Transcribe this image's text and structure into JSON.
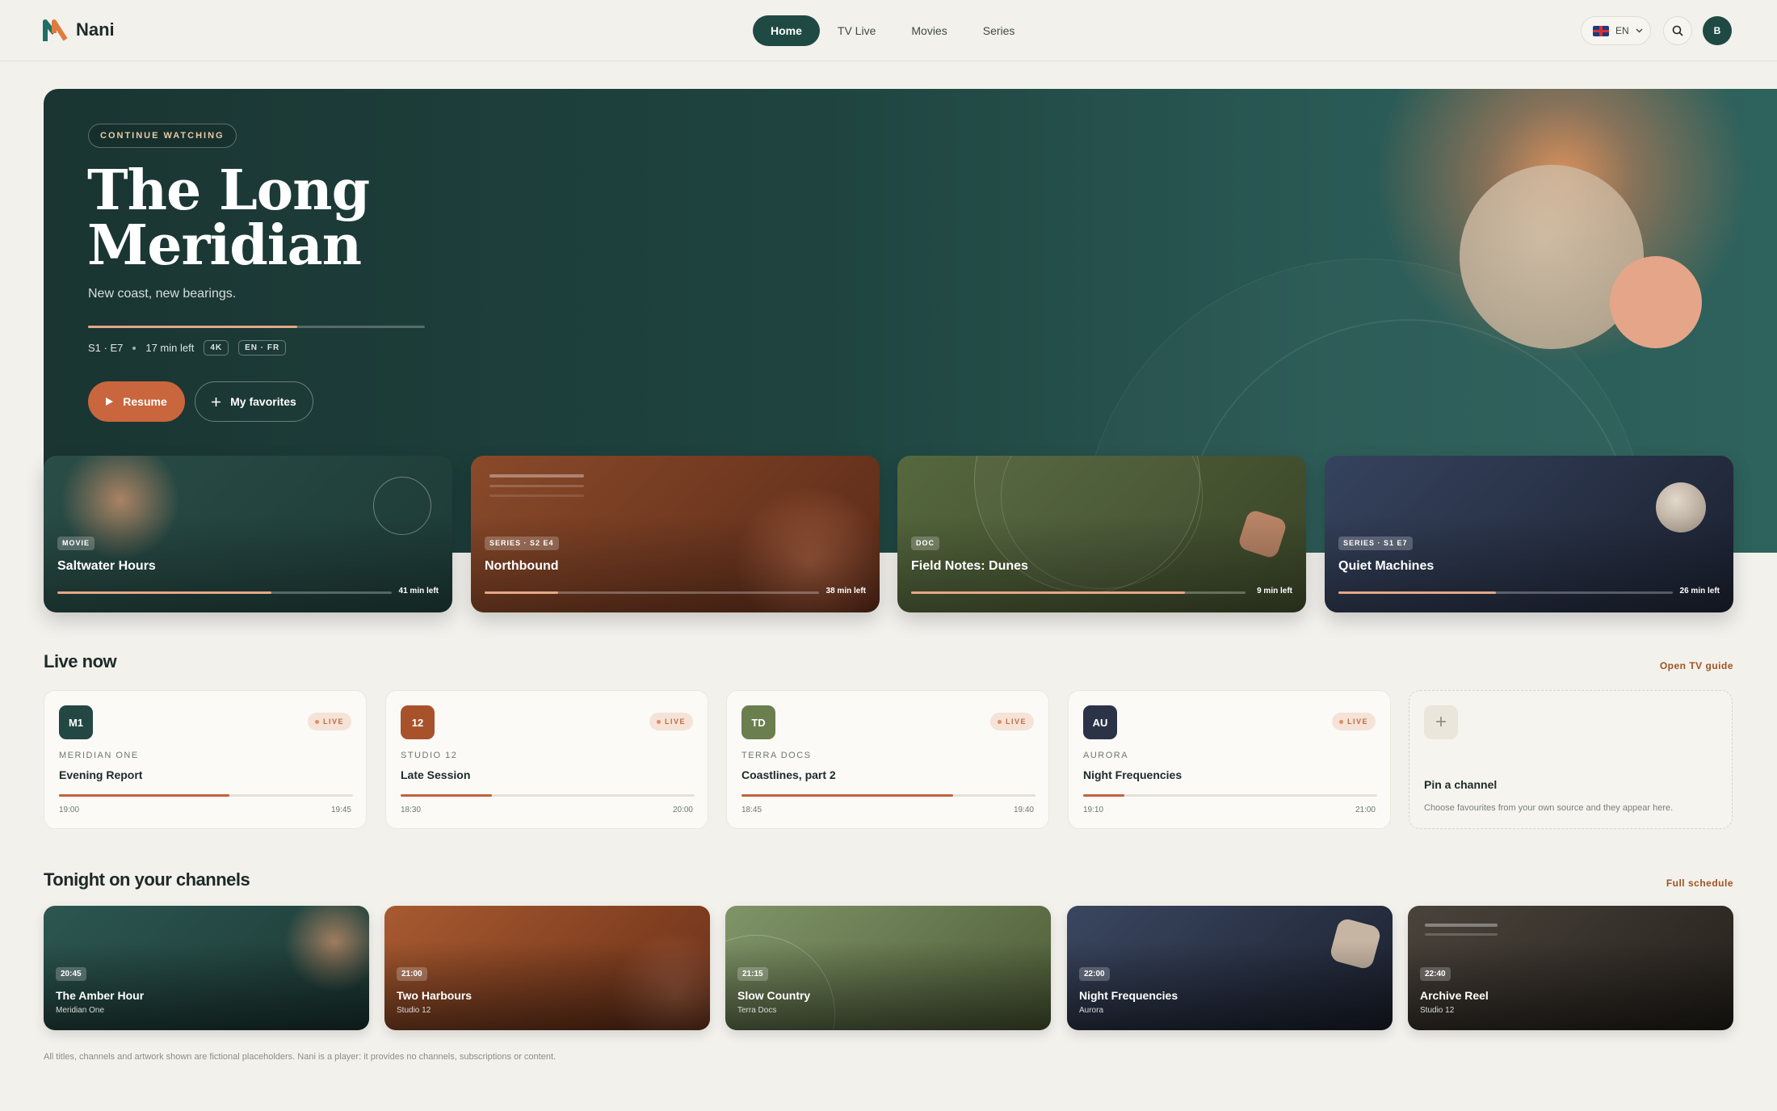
{
  "app": {
    "name": "Nani"
  },
  "nav": {
    "items": [
      "Home",
      "TV Live",
      "Movies",
      "Series"
    ],
    "active": "Home"
  },
  "header": {
    "language": "EN",
    "avatar_initial": "B"
  },
  "hero": {
    "pill": "CONTINUE WATCHING",
    "title": "The Long Meridian",
    "subtitle": "New coast, new bearings.",
    "progress": 0.62,
    "episode": "S1 · E7",
    "time_left": "17 min left",
    "tags": [
      "4K",
      "EN · FR"
    ],
    "resume_label": "Resume",
    "favorites_label": "My favorites"
  },
  "continue_cards": [
    {
      "badge": "MOVIE",
      "title": "Saltwater Hours",
      "progress": 0.64,
      "left": "41 min left",
      "bg": "#234843"
    },
    {
      "badge": "SERIES · S2 E4",
      "title": "Northbound",
      "progress": 0.22,
      "left": "38 min left",
      "bg": "#7a3c22"
    },
    {
      "badge": "DOC",
      "title": "Field Notes: Dunes",
      "progress": 0.82,
      "left": "9 min left",
      "bg": "#4a5a35"
    },
    {
      "badge": "SERIES · S1 E7",
      "title": "Quiet Machines",
      "progress": 0.47,
      "left": "26 min left",
      "bg": "#27324a"
    }
  ],
  "live": {
    "title": "Live now",
    "link": "Open TV guide",
    "badge": "LIVE",
    "channels": [
      {
        "logo": "M1",
        "color": "#234843",
        "channel": "MERIDIAN ONE",
        "program": "Evening Report",
        "start": "19:00",
        "end": "19:45",
        "progress": 0.58
      },
      {
        "logo": "12",
        "color": "#a8522c",
        "channel": "STUDIO 12",
        "program": "Late Session",
        "start": "18:30",
        "end": "20:00",
        "progress": 0.31
      },
      {
        "logo": "TD",
        "color": "#6b7f4e",
        "channel": "TERRA DOCS",
        "program": "Coastlines, part 2",
        "start": "18:45",
        "end": "19:40",
        "progress": 0.72
      },
      {
        "logo": "AU",
        "color": "#2b3447",
        "channel": "AURORA",
        "program": "Night Frequencies",
        "start": "19:10",
        "end": "21:00",
        "progress": 0.14
      }
    ],
    "pin_title": "Pin a channel",
    "pin_desc": "Choose favourites from your own source and they appear here."
  },
  "tonight": {
    "title": "Tonight on your channels",
    "link": "Full schedule",
    "items": [
      {
        "time": "20:45",
        "title": "The Amber Hour",
        "channel": "Meridian One",
        "bg": "#244a45"
      },
      {
        "time": "21:00",
        "title": "Two Harbours",
        "channel": "Studio 12",
        "bg": "#8a4424"
      },
      {
        "time": "21:15",
        "title": "Slow Country",
        "channel": "Terra Docs",
        "bg": "#6b7f4e"
      },
      {
        "time": "22:00",
        "title": "Night Frequencies",
        "channel": "Aurora",
        "bg": "#2b3447"
      },
      {
        "time": "22:40",
        "title": "Archive Reel",
        "channel": "Studio 12",
        "bg": "#3c3731"
      }
    ]
  },
  "footer": {
    "note": "All titles, channels and artwork shown are fictional placeholders. Nani is a player: it provides no channels, subscriptions or content."
  }
}
